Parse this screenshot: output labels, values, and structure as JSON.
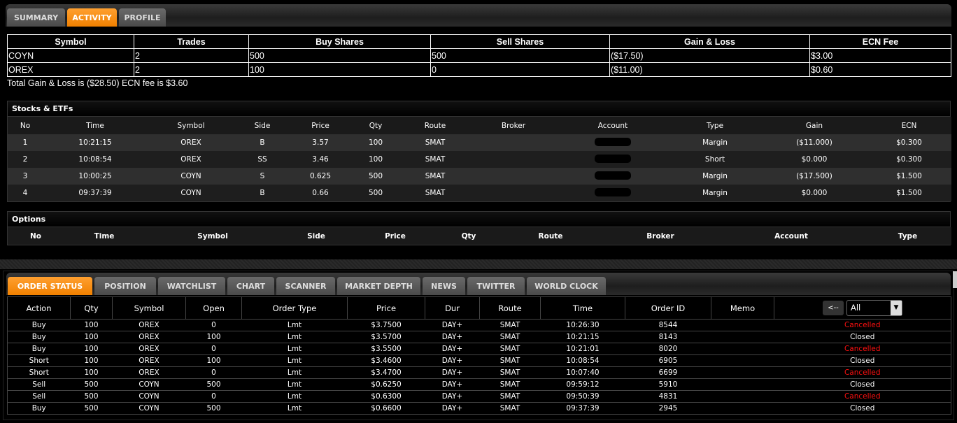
{
  "top_tabs": [
    "SUMMARY",
    "ACTIVITY",
    "PROFILE"
  ],
  "summary": {
    "headers": [
      "Symbol",
      "Trades",
      "Buy Shares",
      "Sell Shares",
      "Gain & Loss",
      "ECN Fee"
    ],
    "rows": [
      [
        "COYN",
        "2",
        "500",
        "500",
        "($17.50)",
        "$3.00"
      ],
      [
        "OREX",
        "2",
        "100",
        "0",
        "($11.00)",
        "$0.60"
      ]
    ],
    "total": "Total Gain & Loss is ($28.50) ECN fee is $3.60"
  },
  "stocks": {
    "title": "Stocks & ETFs",
    "headers": [
      "No",
      "Time",
      "Symbol",
      "Side",
      "Price",
      "Qty",
      "Route",
      "Broker",
      "Account",
      "Type",
      "Gain",
      "ECN"
    ],
    "rows": [
      [
        "1",
        "10:21:15",
        "OREX",
        "B",
        "3.57",
        "100",
        "SMAT",
        "",
        "",
        "Margin",
        "($11.000)",
        "$0.300"
      ],
      [
        "2",
        "10:08:54",
        "OREX",
        "SS",
        "3.46",
        "100",
        "SMAT",
        "",
        "",
        "Short",
        "$0.000",
        "$0.300"
      ],
      [
        "3",
        "10:00:25",
        "COYN",
        "S",
        "0.625",
        "500",
        "SMAT",
        "",
        "",
        "Margin",
        "($17.500)",
        "$1.500"
      ],
      [
        "4",
        "09:37:39",
        "COYN",
        "B",
        "0.66",
        "500",
        "SMAT",
        "",
        "",
        "Margin",
        "$0.000",
        "$1.500"
      ]
    ]
  },
  "options": {
    "title": "Options",
    "headers": [
      "No",
      "Time",
      "Symbol",
      "Side",
      "Price",
      "Qty",
      "Route",
      "Broker",
      "Account",
      "Type"
    ]
  },
  "bottom_tabs": [
    "ORDER STATUS",
    "POSITION",
    "WATCHLIST",
    "CHART",
    "SCANNER",
    "MARKET DEPTH",
    "NEWS",
    "TWITTER",
    "WORLD CLOCK"
  ],
  "orders": {
    "headers": [
      "Action",
      "Qty",
      "Symbol",
      "Open",
      "Order Type",
      "Price",
      "Dur",
      "Route",
      "Time",
      "Order ID",
      "Memo"
    ],
    "back_label": "<--",
    "filter_value": "All",
    "rows": [
      [
        "Buy",
        "100",
        "OREX",
        "0",
        "Lmt",
        "$3.7500",
        "DAY+",
        "SMAT",
        "10:26:30",
        "8544",
        "",
        "Cancelled"
      ],
      [
        "Buy",
        "100",
        "OREX",
        "100",
        "Lmt",
        "$3.5700",
        "DAY+",
        "SMAT",
        "10:21:15",
        "8143",
        "",
        "Closed"
      ],
      [
        "Buy",
        "100",
        "OREX",
        "0",
        "Lmt",
        "$3.5500",
        "DAY+",
        "SMAT",
        "10:21:01",
        "8020",
        "",
        "Cancelled"
      ],
      [
        "Short",
        "100",
        "OREX",
        "100",
        "Lmt",
        "$3.4600",
        "DAY+",
        "SMAT",
        "10:08:54",
        "6905",
        "",
        "Closed"
      ],
      [
        "Short",
        "100",
        "OREX",
        "0",
        "Lmt",
        "$3.4700",
        "DAY+",
        "SMAT",
        "10:07:40",
        "6699",
        "",
        "Cancelled"
      ],
      [
        "Sell",
        "500",
        "COYN",
        "500",
        "Lmt",
        "$0.6250",
        "DAY+",
        "SMAT",
        "09:59:12",
        "5910",
        "",
        "Closed"
      ],
      [
        "Sell",
        "500",
        "COYN",
        "0",
        "Lmt",
        "$0.6300",
        "DAY+",
        "SMAT",
        "09:50:39",
        "4831",
        "",
        "Cancelled"
      ],
      [
        "Buy",
        "500",
        "COYN",
        "500",
        "Lmt",
        "$0.6600",
        "DAY+",
        "SMAT",
        "09:37:39",
        "2945",
        "",
        "Closed"
      ]
    ]
  },
  "colors": {
    "accent": "#f08000",
    "cancelled": "#ff1010"
  }
}
